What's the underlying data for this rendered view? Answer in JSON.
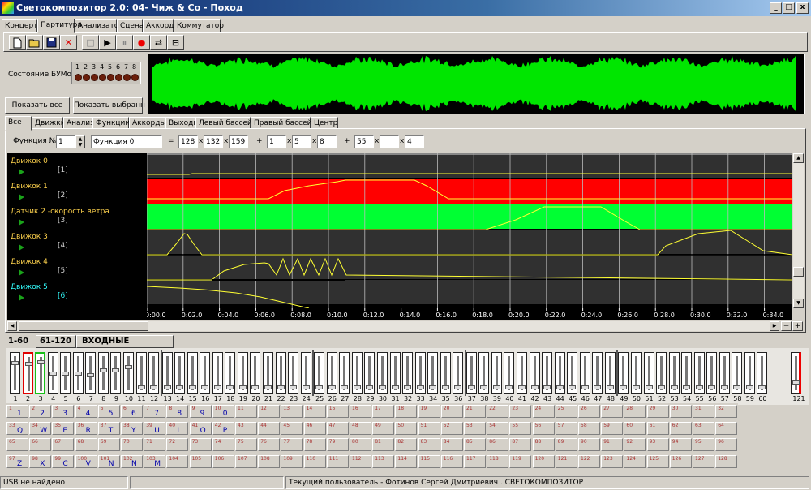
{
  "window": {
    "title": "Светокомпозитор 2.0:     04- Чиж & Co - Поход",
    "min_label": "_",
    "max_label": "□",
    "close_label": "x"
  },
  "main_tabs": [
    "Концерт",
    "Партитура",
    "Анализатор",
    "Сцена",
    "Аккорд",
    "Коммутатор"
  ],
  "active_main_tab": "Партитура",
  "toolbar_icons": [
    "new-file-icon",
    "open-folder-icon",
    "save-icon",
    "delete-icon",
    "stop-icon",
    "play-icon",
    "pause-icon",
    "record-icon",
    "loop-icon",
    "equalizer-icon"
  ],
  "bum": {
    "label": "Состояние БУМов",
    "numbers": [
      "1",
      "2",
      "3",
      "4",
      "5",
      "6",
      "7",
      "8"
    ]
  },
  "buttons": {
    "show_all": "Показать все",
    "show_selected": "Показать выбранн"
  },
  "sub_tabs": [
    "Все",
    "Движки",
    "Анализ.",
    "Функции",
    "Аккорды",
    "Выходы",
    "Левый бассейн",
    "Правый бассейн",
    "Центр"
  ],
  "function_row": {
    "label": "Функция №",
    "number": "1",
    "name": "Функция 0",
    "eq": "=",
    "plus": "+",
    "x": "x",
    "group1": [
      "128",
      "132",
      "159"
    ],
    "group2": [
      "1",
      "5",
      "8"
    ],
    "group3": [
      "55",
      "",
      "4"
    ]
  },
  "motors": [
    {
      "name": "Движок 0",
      "num": "[1]"
    },
    {
      "name": "Движок 1",
      "num": "[2]"
    },
    {
      "name": "Датчик 2 -скорость ветра",
      "num": "[3]"
    },
    {
      "name": "Движок 3",
      "num": "[4]"
    },
    {
      "name": "Движок 4",
      "num": "[5]"
    },
    {
      "name": "Движок 5",
      "num": "[6]"
    }
  ],
  "time_ticks": [
    "0:00.0",
    "0:02.0",
    "0:04.0",
    "0:06.0",
    "0:08.0",
    "0:10.0",
    "0:12.0",
    "0:14.0",
    "0:16.0",
    "0:18.0",
    "0:20.0",
    "0:22.0",
    "0:24.0",
    "0:26.0",
    "0:28.0",
    "0:30.0",
    "0:32.0",
    "0:34.0"
  ],
  "zoom": {
    "out": "−",
    "in": "+"
  },
  "range_tabs": [
    "1-60",
    "61-120"
  ],
  "input_signals_label": "ВХОДНЫЕ СИГНАЛЫ",
  "fader_numbers": [
    "1",
    "2",
    "3",
    "4",
    "5",
    "6",
    "7",
    "8",
    "9",
    "10",
    "11",
    "12",
    "13",
    "14",
    "15",
    "16",
    "17",
    "18",
    "19",
    "20",
    "21",
    "22",
    "23",
    "24",
    "25",
    "26",
    "27",
    "28",
    "29",
    "30",
    "31",
    "32",
    "33",
    "34",
    "35",
    "36",
    "37",
    "38",
    "39",
    "40",
    "41",
    "42",
    "43",
    "44",
    "45",
    "46",
    "47",
    "48",
    "49",
    "50",
    "51",
    "52",
    "53",
    "54",
    "55",
    "56",
    "57",
    "58",
    "59",
    "60"
  ],
  "master_fader": "121",
  "fader_levels": [
    0.85,
    0.85,
    0.9,
    0.5,
    0.5,
    0.5,
    0.45,
    0.6,
    0.6,
    0.7
  ],
  "keys": {
    "row1": [
      "1",
      "2",
      "3",
      "4",
      "5",
      "6",
      "7",
      "8",
      "9",
      "0"
    ],
    "row2": [
      "Q",
      "W",
      "E",
      "R",
      "T",
      "Y",
      "U",
      "I",
      "O",
      "P"
    ],
    "row4": [
      "Z",
      "X",
      "C",
      "V",
      "N",
      "N",
      "M"
    ]
  },
  "status": {
    "usb": "USB не найдено",
    "user": "Текущий пользователь - Фотинов Сергей Дмитриевич . СВЕТОКОМПОЗИТОР"
  },
  "colors": {
    "waveform": "#00e600",
    "lane_red": "#ff0000",
    "lane_green": "#00ff33",
    "curve": "#ffff33",
    "red_select": "#e00000",
    "green_select": "#18c018"
  }
}
